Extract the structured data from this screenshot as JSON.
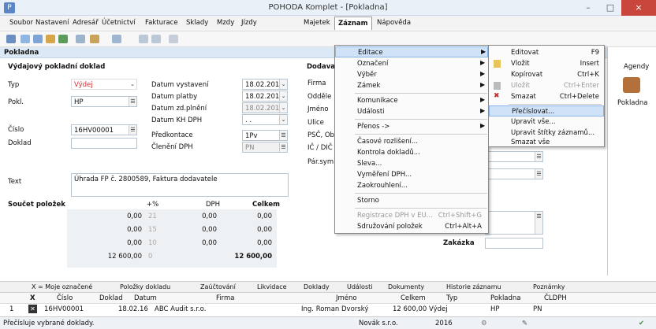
{
  "window": {
    "title": "POHODA Komplet - [Pokladna]",
    "min": "–",
    "max": "□",
    "close": "×"
  },
  "menubar": [
    "Soubor",
    "Nastavení",
    "Adresář",
    "Účetnictví",
    "Fakturace",
    "Sklady",
    "Mzdy",
    "Jízdy",
    "Majetek",
    "Záznam",
    "Nápověda"
  ],
  "panel": {
    "title": "Pokladna",
    "section": "Výdajový pokladní doklad",
    "dodava": "Dodava"
  },
  "form": {
    "typ_label": "Typ",
    "typ_value": "Výdej",
    "pokl_label": "Pokl.",
    "pokl_value": "HP",
    "cislo_label": "Číslo",
    "cislo_value": "16HV00001",
    "doklad_label": "Doklad",
    "text_label": "Text",
    "text_value": "Úhrada FP č. 2800589, Faktura dodavatele",
    "datum_vystaveni_label": "Datum vystavení",
    "datum_vystaveni": "18.02.2016",
    "datum_platby_label": "Datum platby",
    "datum_platby": "18.02.2016",
    "datum_zd_label": "Datum zd.plnění",
    "datum_zd": "18.02.2016",
    "datum_kh_label": "Datum KH DPH",
    "datum_kh": ". .",
    "predkontace_label": "Předkontace",
    "predkontace": "1Pv",
    "cleneni_label": "Členění DPH",
    "cleneni": "PN",
    "right_labels": [
      "Firma",
      "Odděle",
      "Jméno",
      "Ulice",
      "PSČ, Ob",
      "IČ / DIČ",
      "Pár.sym"
    ],
    "zakazka": "Zakázka"
  },
  "summary": {
    "title": "Součet položek",
    "h_pct": "+%",
    "h_dph": "DPH",
    "h_celkem": "Celkem",
    "rows": [
      {
        "base": "0,00",
        "pct": "21",
        "dph": "0,00",
        "celkem": "0,00"
      },
      {
        "base": "0,00",
        "pct": "15",
        "dph": "0,00",
        "celkem": "0,00"
      },
      {
        "base": "0,00",
        "pct": "10",
        "dph": "0,00",
        "celkem": "0,00"
      },
      {
        "base": "12 600,00",
        "pct": "0",
        "dph": "",
        "celkem": "12 600,00"
      }
    ]
  },
  "zaznam_menu": [
    {
      "label": "Editace",
      "arrow": "▶"
    },
    {
      "label": "Označení",
      "arrow": "▶"
    },
    {
      "label": "Výběr",
      "arrow": "▶"
    },
    {
      "label": "Zámek",
      "arrow": "▶"
    },
    {
      "label": "Komunikace",
      "arrow": "▶"
    },
    {
      "label": "Události",
      "arrow": "▶"
    },
    {
      "label": "Přenos ->",
      "arrow": "▶"
    },
    {
      "label": "Časové rozlišení..."
    },
    {
      "label": "Kontrola dokladů..."
    },
    {
      "label": "Sleva..."
    },
    {
      "label": "Vyměření DPH..."
    },
    {
      "label": "Zaokrouhlení..."
    },
    {
      "label": "Storno"
    },
    {
      "label": "Registrace DPH v EU...",
      "shortcut": "Ctrl+Shift+G"
    },
    {
      "label": "Sdružování položek",
      "shortcut": "Ctrl+Alt+A"
    }
  ],
  "editace_menu": [
    {
      "label": "Editovat",
      "shortcut": "F9"
    },
    {
      "label": "Vložit",
      "shortcut": "Insert"
    },
    {
      "label": "Kopírovat",
      "shortcut": "Ctrl+K"
    },
    {
      "label": "Uložit",
      "shortcut": "Ctrl+Enter"
    },
    {
      "label": "Smazat",
      "shortcut": "Ctrl+Delete"
    },
    {
      "label": "Přečíslovat..."
    },
    {
      "label": "Upravit vše..."
    },
    {
      "label": "Upravit štítky záznamů..."
    },
    {
      "label": "Smazat vše"
    }
  ],
  "agenda": {
    "header": "Agendy",
    "item": "Pokladna"
  },
  "tabs": [
    "X = Moje označené",
    "Položky dokladu",
    "Zaúčtování",
    "Likvidace",
    "Doklady",
    "Události",
    "Dokumenty",
    "Historie záznamu",
    "Poznámky"
  ],
  "grid": {
    "headers": [
      "X",
      "Číslo",
      "Doklad",
      "Datum",
      "Firma",
      "Jméno",
      "Celkem",
      "Typ",
      "Pokladna",
      "ČLDPH"
    ],
    "row": {
      "num": "1",
      "cislo": "16HV00001",
      "datum": "18.02.16",
      "firma": "ABC Audit s.r.o.",
      "jmeno": "Ing. Roman Dvorský",
      "celkem": "12 600,00",
      "typ": "Výdej",
      "pokladna": "HP",
      "cldph": "PN"
    }
  },
  "status": {
    "text": "Přečísluje vybrané doklady.",
    "firma": "Novák s.r.o.",
    "rok": "2016"
  }
}
